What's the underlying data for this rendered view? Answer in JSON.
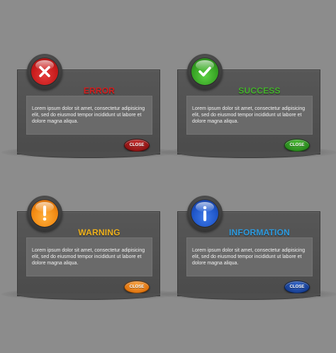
{
  "colors": {
    "background": "#8c8c8c",
    "panel": "#525252"
  },
  "dialogs": [
    {
      "type": "error",
      "title": "ERROR",
      "title_color": "#d41d1d",
      "icon": "x-icon",
      "orb_color": "#c81c1c",
      "body": "Lorem ipsum dolor sit amet, consectetur adipisicing elit, sed do eiusmod tempor incididunt ut labore et dolore magna aliqua.",
      "close_label": "CLOSE",
      "close_color": "#8e1414"
    },
    {
      "type": "success",
      "title": "SUCCESS",
      "title_color": "#44b12c",
      "icon": "check-icon",
      "orb_color": "#37a324",
      "body": "Lorem ipsum dolor sit amet, consectetur adipisicing elit, sed do eiusmod tempor incididunt ut labore et dolore magna aliqua.",
      "close_label": "CLOSE",
      "close_color": "#2a8a1e"
    },
    {
      "type": "warning",
      "title": "WARNING",
      "title_color": "#f0b21c",
      "icon": "exclamation-icon",
      "orb_color": "#f28a12",
      "body": "Lorem ipsum dolor sit amet, consectetur adipisicing elit, sed do eiusmod tempor incididunt ut labore et dolore magna aliqua.",
      "close_label": "CLOSE",
      "close_color": "#e0740e"
    },
    {
      "type": "information",
      "title": "INFORMATION",
      "title_color": "#2c9be0",
      "icon": "info-icon",
      "orb_color": "#1f56c9",
      "body": "Lorem ipsum dolor sit amet, consectetur adipisicing elit, sed do eiusmod tempor incididunt ut labore et dolore magna aliqua.",
      "close_label": "CLOSE",
      "close_color": "#173f92"
    }
  ]
}
